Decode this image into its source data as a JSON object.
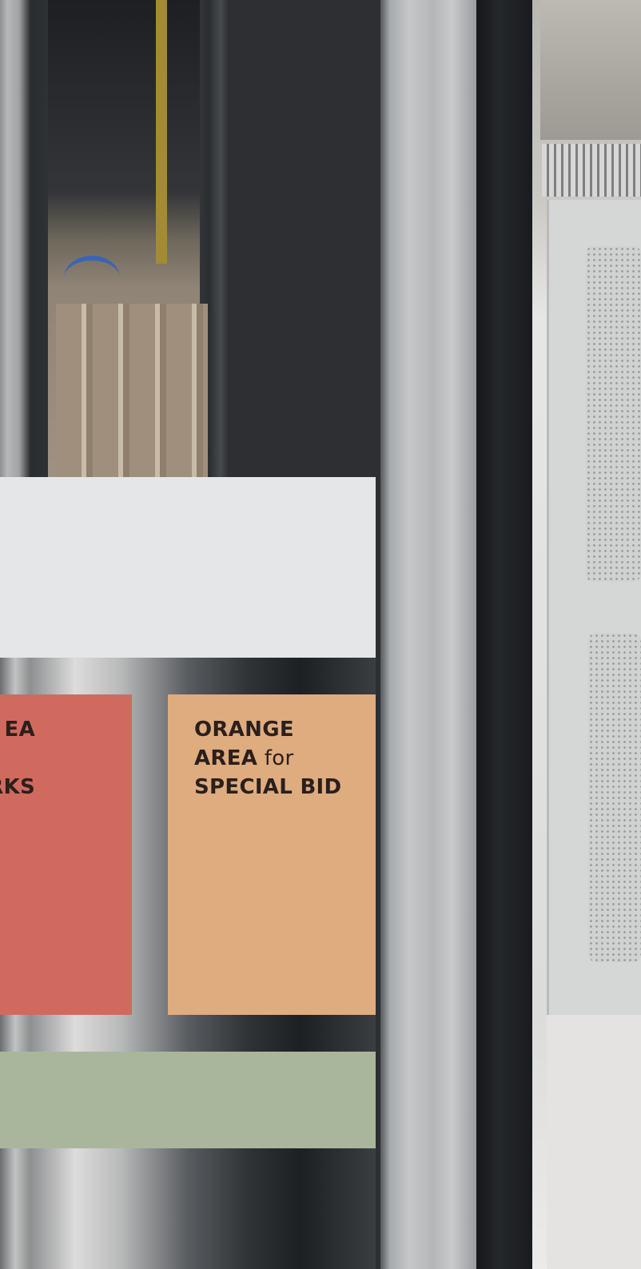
{
  "colors": {
    "gray_panel": "#e5e6e8",
    "red_panel": "#d06a5e",
    "orange_panel": "#dfac7f",
    "green_panel": "#a9b69c",
    "text": "#2a1f1c"
  },
  "red_panel": {
    "line1": "EA",
    "line2": "",
    "line3": "RKS"
  },
  "orange_panel": {
    "line1": "ORANGE",
    "line2_bold": "AREA",
    "line2_normal": " for",
    "line3": "SPECIAL BID"
  }
}
